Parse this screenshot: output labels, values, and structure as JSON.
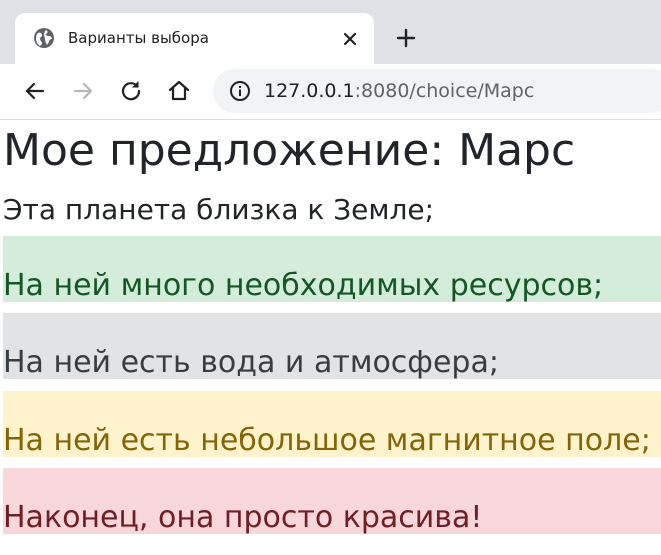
{
  "browser": {
    "tab": {
      "title": "Варианты выбора",
      "icon": "globe-icon",
      "close_icon": "close-icon"
    },
    "new_tab_icon": "plus-icon",
    "nav": {
      "back_icon": "arrow-left-icon",
      "forward_icon": "arrow-right-icon",
      "reload_icon": "reload-icon",
      "home_icon": "home-icon"
    },
    "address_bar": {
      "icon": "info-icon",
      "host": "127.0.0.1",
      "rest": ":8080/choice/Марс"
    }
  },
  "page": {
    "heading": "Мое предложение: Марс",
    "first_reason": "Эта планета близка к Земле;",
    "reasons": [
      {
        "text": "На ней много необходимых ресурсов;",
        "bg": "#d4edda",
        "color": "#155724"
      },
      {
        "text": "На ней есть вода и атмосфера;",
        "bg": "#e2e3e5",
        "color": "#383d41"
      },
      {
        "text": "На ней есть небольшое магнитное поле;",
        "bg": "#fff3cd",
        "color": "#856404"
      },
      {
        "text": "Наконец, она просто красива!",
        "bg": "#f8d7da",
        "color": "#721c24"
      }
    ]
  }
}
